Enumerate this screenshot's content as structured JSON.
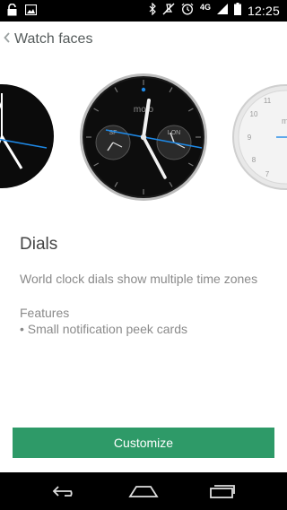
{
  "status_bar": {
    "time": "12:25",
    "network": "4G",
    "icons": [
      "lock-icon",
      "image-icon",
      "bluetooth-icon",
      "mute-icon",
      "alarm-icon",
      "signal-icon",
      "battery-icon"
    ]
  },
  "action_bar": {
    "title": "Watch faces"
  },
  "carousel": {
    "faces": [
      {
        "name": "left-dial",
        "style": "dark"
      },
      {
        "name": "world-clock-dial",
        "style": "dark",
        "brand": "moto",
        "subdial_left": "SF",
        "subdial_right": "LON"
      },
      {
        "name": "right-dial",
        "style": "light",
        "brand": "mo"
      }
    ]
  },
  "details": {
    "title": "Dials",
    "description": "World clock dials show multiple time zones",
    "features_label": "Features",
    "features": [
      "• Small notification peek cards"
    ]
  },
  "customize_label": "Customize",
  "nav_bar": {
    "icons": [
      "back-icon",
      "home-icon",
      "recent-apps-icon"
    ]
  },
  "colors": {
    "accent": "#2e9a68",
    "second_hand": "#1e88e5"
  }
}
